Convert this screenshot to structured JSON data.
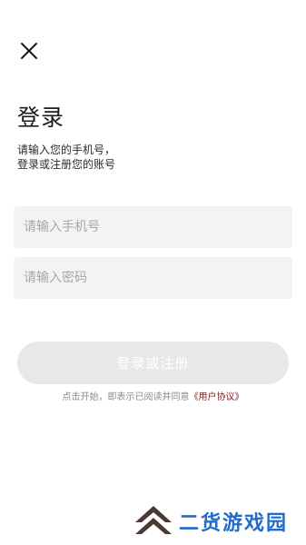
{
  "icons": {
    "close": "close-icon",
    "logo": "chevron-stack-logo"
  },
  "title": "登录",
  "subtitle": {
    "line1": "请输入您的手机号，",
    "line2": "登录或注册您的账号"
  },
  "form": {
    "phone_placeholder": "请输入手机号",
    "phone_value": "",
    "password_placeholder": "请输入密码",
    "password_value": "",
    "submit_label": "登录或注册"
  },
  "agreement": {
    "prefix": "点击开始，即表示已阅读并同意",
    "link": "《用户协议》"
  },
  "watermark": {
    "text": "二货游戏园"
  },
  "colors": {
    "field_background": "#f3f3f3",
    "button_disabled": "#e8e8e8",
    "agreement_link": "#7a2424",
    "watermark_text": "#1f6bd0",
    "watermark_logo": "#4a3a33"
  }
}
